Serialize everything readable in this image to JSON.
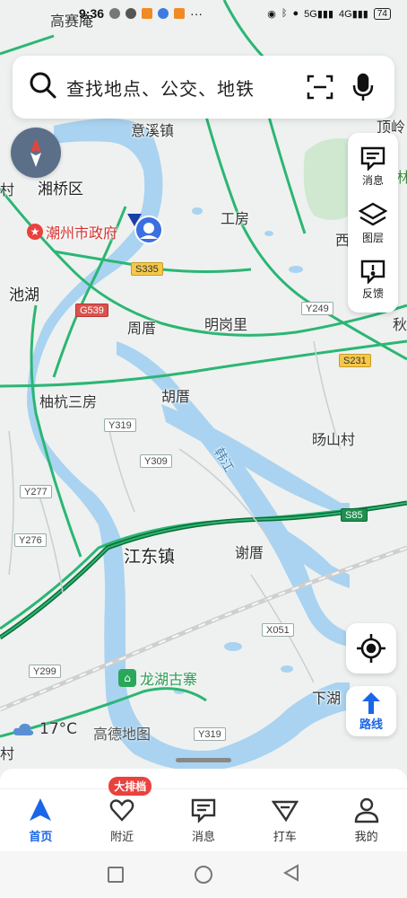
{
  "status_bar": {
    "time": "9:36",
    "battery": "74",
    "signal_a": "5G",
    "signal_b": "4G"
  },
  "search": {
    "placeholder": "查找地点、公交、地铁"
  },
  "map_labels": {
    "gaosaian": "高赛庵",
    "yixizhen": "意溪镇",
    "xiangqiaoqu": "湘桥区",
    "cunleft": "村",
    "chaozhou_gov": "潮州市政府",
    "gongfang": "工房",
    "xi": "西",
    "chihu": "池湖",
    "zhoucuo": "周厝",
    "minggangli": "明岗里",
    "qiu": "秋",
    "youhangsanfang": "柚杭三房",
    "hucuo": "胡厝",
    "hanjiang": "韩江",
    "yangshancun": "旸山村",
    "jiangdongzhen": "江东镇",
    "xiecuo": "谢厝",
    "longhuguzhai": "龙湖古寨",
    "xiahu": "下湖",
    "cunbottom": "村",
    "dingling": "顶岭",
    "lin": "林"
  },
  "road_shields": {
    "s335": "S335",
    "g539": "G539",
    "y249": "Y249",
    "s231": "S231",
    "y319a": "Y319",
    "y309": "Y309",
    "y277": "Y277",
    "y276": "Y276",
    "s85": "S85",
    "x051": "X051",
    "y299": "Y299",
    "y319b": "Y319"
  },
  "tools": {
    "messages": "消息",
    "layers": "图层",
    "feedback": "反馈"
  },
  "route_label": "路线",
  "weather": {
    "temp": "17°C"
  },
  "brand": "高德地图",
  "tabs": [
    {
      "label": "首页",
      "icon": "navigation-arrow-icon"
    },
    {
      "label": "附近",
      "icon": "nearby-heart-icon",
      "badge": "大排档"
    },
    {
      "label": "消息",
      "icon": "message-icon"
    },
    {
      "label": "打车",
      "icon": "taxi-icon"
    },
    {
      "label": "我的",
      "icon": "profile-icon"
    }
  ],
  "colors": {
    "accent": "#1a66e8",
    "water": "#a9d3f0",
    "road": "#2bb673",
    "expressway": "#1f8f4f",
    "badge": "#e9423d"
  }
}
